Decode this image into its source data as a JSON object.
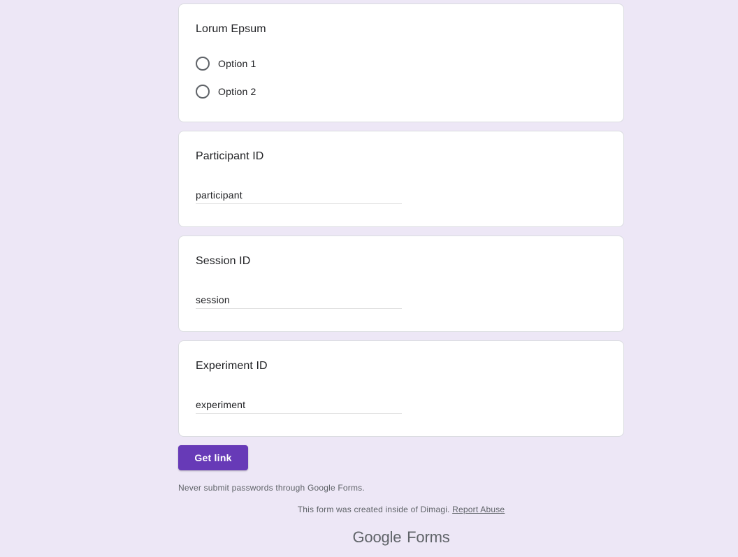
{
  "questions": {
    "q1": {
      "title": "Lorum Epsum",
      "options": [
        "Option 1",
        "Option 2"
      ]
    },
    "q2": {
      "title": "Participant ID",
      "value": "participant"
    },
    "q3": {
      "title": "Session ID",
      "value": "session"
    },
    "q4": {
      "title": "Experiment ID",
      "value": "experiment"
    }
  },
  "actions": {
    "submit_label": "Get link"
  },
  "footer": {
    "warning": "Never submit passwords through Google Forms.",
    "created_text": "This form was created inside of Dimagi.",
    "report_link": "Report Abuse",
    "brand_google": "Google",
    "brand_forms": "Forms"
  },
  "colors": {
    "background": "#ede7f6",
    "accent": "#673ab7"
  }
}
